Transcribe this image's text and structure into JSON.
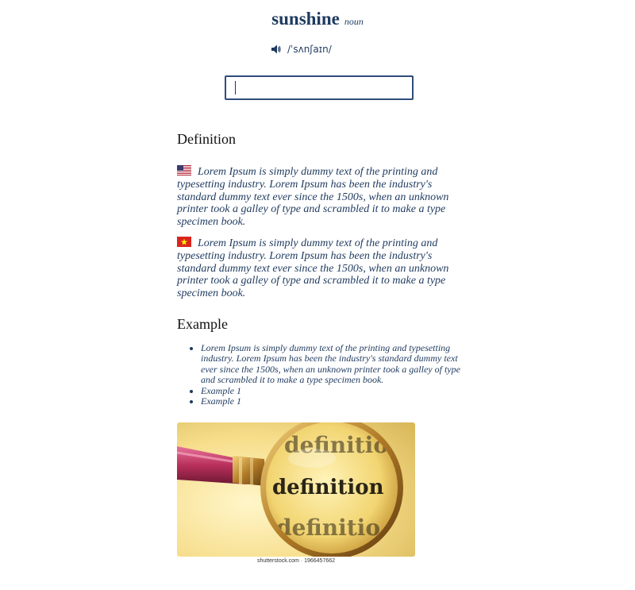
{
  "header": {
    "word": "sunshine",
    "part_of_speech": "noun",
    "phonetic": "/ˈsʌnʃaɪn/"
  },
  "search": {
    "value": "",
    "placeholder": ""
  },
  "definition_section": {
    "title": "Definition",
    "entries": [
      {
        "flag": "us-flag-icon",
        "text": "Lorem Ipsum is simply dummy text of the printing and typesetting industry. Lorem Ipsum has been the industry's standard dummy text ever since the 1500s, when an unknown printer took a galley of type and scrambled it to make a type specimen book."
      },
      {
        "flag": "vietnam-flag-icon",
        "text": "Lorem Ipsum is simply dummy text of the printing and typesetting industry. Lorem Ipsum has been the industry's standard dummy text ever since the 1500s, when an unknown printer took a galley of type and scrambled it to make a type specimen book."
      }
    ]
  },
  "example_section": {
    "title": "Example",
    "items": [
      "Lorem Ipsum is simply dummy text of the printing and typesetting industry. Lorem Ipsum has been the industry's standard dummy text ever since the 1500s, when an unknown printer took a galley of type and scrambled it to make a type specimen book.",
      "Example 1",
      "Example 1"
    ]
  },
  "image": {
    "lens_text": "definition",
    "lens_text_top": "definitio",
    "lens_text_bottom": "definitio",
    "credit": "shutterstock.com · 1966457662"
  },
  "colors": {
    "text_primary": "#1e3a5f",
    "search_border": "#2f4d7a",
    "us_flag_red": "#b22234",
    "vn_flag_red": "#da251d",
    "vn_flag_star": "#ffff00"
  }
}
